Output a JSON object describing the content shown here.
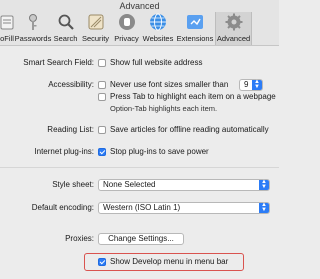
{
  "window": {
    "title": "Advanced"
  },
  "toolbar": {
    "items": [
      {
        "label": "oFill",
        "icon": "autofill-icon"
      },
      {
        "label": "Passwords",
        "icon": "key-icon"
      },
      {
        "label": "Search",
        "icon": "search-icon"
      },
      {
        "label": "Security",
        "icon": "lock-icon"
      },
      {
        "label": "Privacy",
        "icon": "hand-icon"
      },
      {
        "label": "Websites",
        "icon": "globe-icon"
      },
      {
        "label": "Extensions",
        "icon": "puzzle-icon"
      },
      {
        "label": "Advanced",
        "icon": "gear-icon"
      }
    ],
    "active": "Advanced"
  },
  "smart_search": {
    "label": "Smart Search Field:",
    "option": "Show full website address",
    "checked": false
  },
  "accessibility": {
    "label": "Accessibility:",
    "min_font": {
      "text": "Never use font sizes smaller than",
      "value": "9",
      "checked": false
    },
    "tab": {
      "text": "Press Tab to highlight each item on a webpage",
      "checked": false
    },
    "tab_note": "Option-Tab highlights each item."
  },
  "reading_list": {
    "label": "Reading List:",
    "option": "Save articles for offline reading automatically",
    "checked": false
  },
  "plugins": {
    "label": "Internet plug-ins:",
    "option": "Stop plug-ins to save power",
    "checked": true
  },
  "stylesheet": {
    "label": "Style sheet:",
    "value": "None Selected"
  },
  "encoding": {
    "label": "Default encoding:",
    "value": "Western (ISO Latin 1)"
  },
  "proxies": {
    "label": "Proxies:",
    "button": "Change Settings..."
  },
  "develop": {
    "option": "Show Develop menu in menu bar",
    "checked": true
  },
  "colors": {
    "accent": "#2c7cf6",
    "highlight": "#d9534f"
  }
}
